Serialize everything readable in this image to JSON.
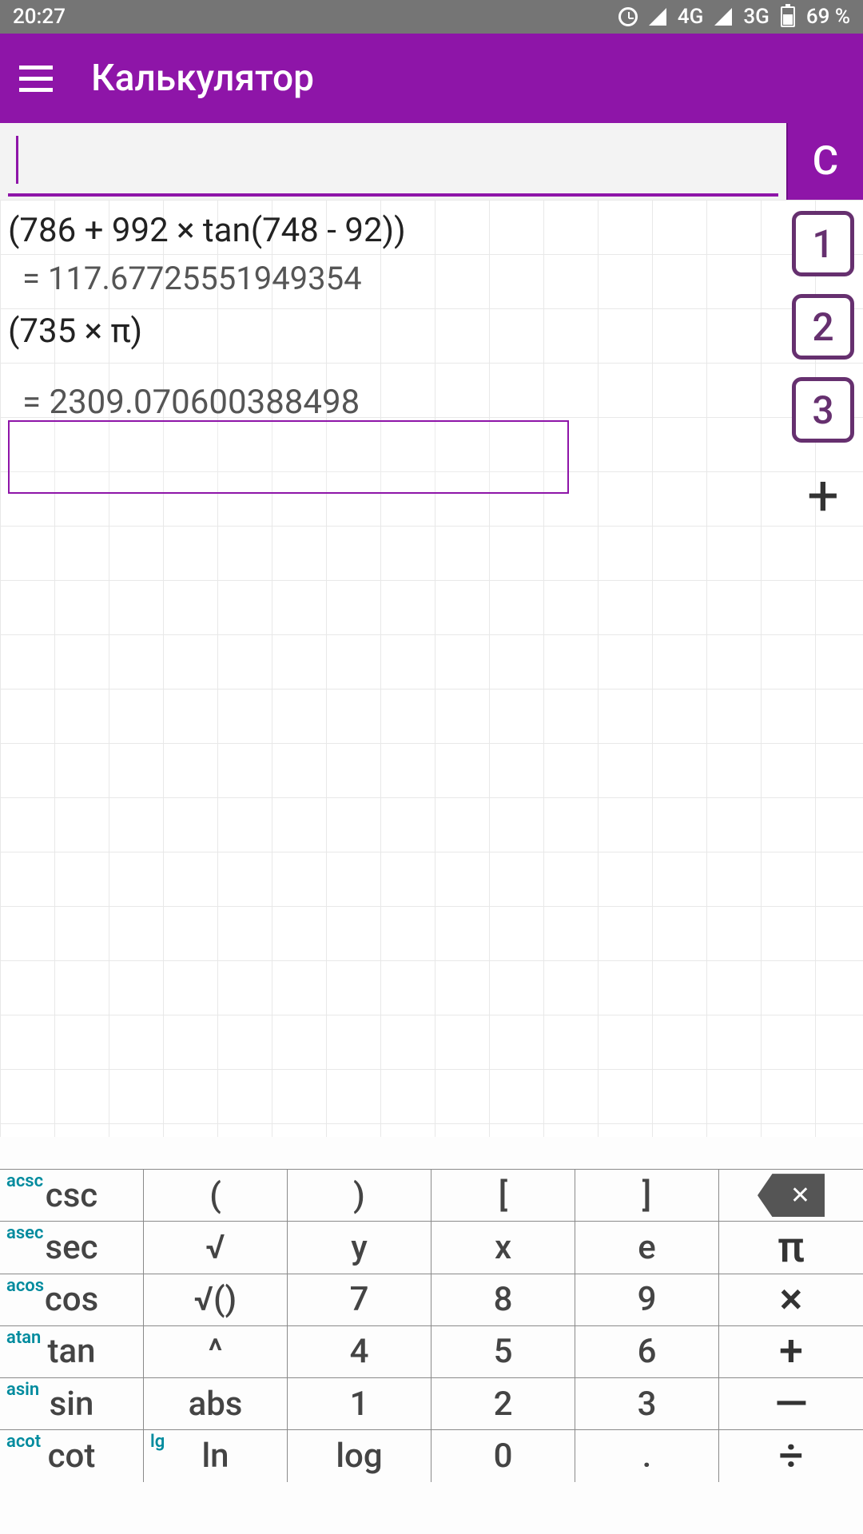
{
  "status": {
    "time": "20:27",
    "net1": "4G",
    "net2": "3G",
    "battery": "69 %"
  },
  "app": {
    "title": "Калькулятор"
  },
  "input": {
    "value": "",
    "clear_label": "C"
  },
  "history": {
    "items": [
      {
        "expr": "(786 + 992 × tan(748 - 92))",
        "result": "= 117.67725551949354"
      },
      {
        "expr": "(735 × π)",
        "result": "= 2309.070600388498"
      }
    ]
  },
  "memory": {
    "slots": [
      "1",
      "2",
      "3"
    ],
    "add": "+"
  },
  "keys": {
    "r1": [
      {
        "alt": "acsc",
        "main": "csc"
      },
      {
        "main": "("
      },
      {
        "main": ")"
      },
      {
        "main": "["
      },
      {
        "main": "]"
      },
      {
        "main": "⌫"
      }
    ],
    "r2": [
      {
        "alt": "asec",
        "main": "sec"
      },
      {
        "main": "√"
      },
      {
        "main": "y"
      },
      {
        "main": "x"
      },
      {
        "main": "e"
      },
      {
        "main": "π"
      }
    ],
    "r3": [
      {
        "alt": "acos",
        "main": "cos"
      },
      {
        "main": "√()"
      },
      {
        "main": "7"
      },
      {
        "main": "8"
      },
      {
        "main": "9"
      },
      {
        "main": "×"
      }
    ],
    "r4": [
      {
        "alt": "atan",
        "main": "tan"
      },
      {
        "main": "^"
      },
      {
        "main": "4"
      },
      {
        "main": "5"
      },
      {
        "main": "6"
      },
      {
        "main": "+"
      }
    ],
    "r5": [
      {
        "alt": "asin",
        "main": "sin"
      },
      {
        "main": "abs"
      },
      {
        "main": "1"
      },
      {
        "main": "2"
      },
      {
        "main": "3"
      },
      {
        "main": "—"
      }
    ],
    "r6": [
      {
        "alt": "acot",
        "main": "cot"
      },
      {
        "alt": "lg",
        "main": "ln"
      },
      {
        "main": "log"
      },
      {
        "main": "0"
      },
      {
        "main": "."
      },
      {
        "main": "÷"
      }
    ]
  }
}
